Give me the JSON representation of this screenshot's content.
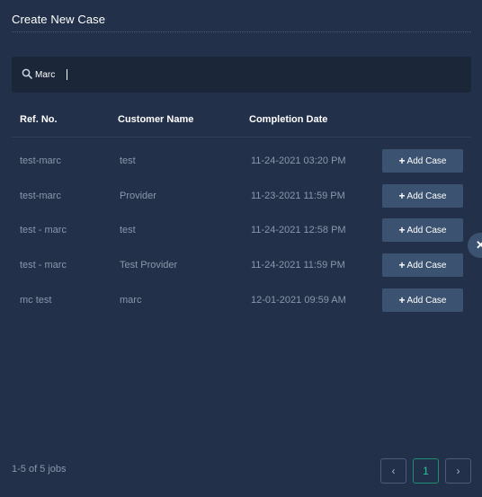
{
  "header": {
    "title": "Create New Case"
  },
  "search": {
    "value": "Marc",
    "icon": "search-icon"
  },
  "table": {
    "columns": [
      "Ref. No.",
      "Customer Name",
      "Completion Date"
    ],
    "rows": [
      {
        "ref": "test-marc",
        "customer": "test",
        "date": "11-24-2021 03:20 PM",
        "action": "Add Case"
      },
      {
        "ref": "test-marc",
        "customer": "Provider",
        "date": "11-23-2021 11:59 PM",
        "action": "Add Case"
      },
      {
        "ref": "test - marc",
        "customer": "test",
        "date": "11-24-2021 12:58 PM",
        "action": "Add Case"
      },
      {
        "ref": "test - marc",
        "customer": "Test Provider",
        "date": "11-24-2021 11:59 PM",
        "action": "Add Case"
      },
      {
        "ref": "mc test",
        "customer": "marc",
        "date": "12-01-2021 09:59 AM",
        "action": "Add Case"
      }
    ]
  },
  "footer": {
    "count": "1-5 of 5 jobs"
  },
  "pagination": {
    "prev": "‹",
    "current": "1",
    "next": "›"
  },
  "colors": {
    "background": "#223049",
    "button": "#3b5371",
    "active_page": "#20c997"
  }
}
